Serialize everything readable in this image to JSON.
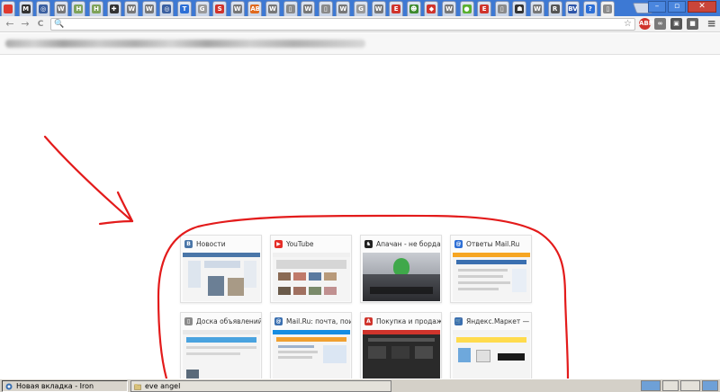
{
  "tabstrip": {
    "tabs": [
      {
        "icon": "opera-red-icon",
        "glyph": "",
        "color": "#e03a2f"
      },
      {
        "icon": "bar-icon",
        "glyph": "M",
        "color": "#333333"
      },
      {
        "icon": "gear-icon",
        "glyph": "◎",
        "color": "#3a5fa0"
      },
      {
        "icon": "wikipedia-icon",
        "glyph": "W",
        "color": "#777777"
      },
      {
        "icon": "h-icon",
        "glyph": "H",
        "color": "#7fa35a"
      },
      {
        "icon": "h-icon",
        "glyph": "H",
        "color": "#7fa35a"
      },
      {
        "icon": "cross-icon",
        "glyph": "✚",
        "color": "#333333"
      },
      {
        "icon": "wikipedia-icon",
        "glyph": "W",
        "color": "#777777"
      },
      {
        "icon": "wikipedia-icon",
        "glyph": "W",
        "color": "#777777"
      },
      {
        "icon": "gear-icon",
        "glyph": "◎",
        "color": "#3a5fa0"
      },
      {
        "icon": "t-icon",
        "glyph": "T",
        "color": "#2d6fd6"
      },
      {
        "icon": "google-icon",
        "glyph": "G",
        "color": "#9a9a9a"
      },
      {
        "icon": "s-icon",
        "glyph": "S",
        "color": "#d0342c"
      },
      {
        "icon": "wikipedia-icon",
        "glyph": "W",
        "color": "#777777"
      },
      {
        "icon": "ab-icon",
        "glyph": "AB",
        "color": "#e06a1e"
      },
      {
        "icon": "wikipedia-icon",
        "glyph": "W",
        "color": "#777777"
      },
      {
        "icon": "document-icon",
        "glyph": "▯",
        "color": "#8a8a8a"
      },
      {
        "icon": "wikipedia-icon",
        "glyph": "W",
        "color": "#777777"
      },
      {
        "icon": "document-icon",
        "glyph": "▯",
        "color": "#8a8a8a"
      },
      {
        "icon": "wikipedia-icon",
        "glyph": "W",
        "color": "#777777"
      },
      {
        "icon": "google-icon",
        "glyph": "G",
        "color": "#9a9a9a"
      },
      {
        "icon": "wikipedia-icon",
        "glyph": "W",
        "color": "#777777"
      },
      {
        "icon": "e-icon",
        "glyph": "E",
        "color": "#d0342c"
      },
      {
        "icon": "alien-icon",
        "glyph": "☻",
        "color": "#3d8a2e"
      },
      {
        "icon": "pocket-icon",
        "glyph": "◆",
        "color": "#d0342c"
      },
      {
        "icon": "wikipedia-icon",
        "glyph": "W",
        "color": "#777777"
      },
      {
        "icon": "green-ball-icon",
        "glyph": "●",
        "color": "#5bb030"
      },
      {
        "icon": "e-icon",
        "glyph": "E",
        "color": "#d0342c"
      },
      {
        "icon": "document-icon",
        "glyph": "▯",
        "color": "#8a8a8a"
      },
      {
        "icon": "mask-icon",
        "glyph": "☗",
        "color": "#333333"
      },
      {
        "icon": "wikipedia-icon",
        "glyph": "W",
        "color": "#777777"
      },
      {
        "icon": "r-icon",
        "glyph": "R",
        "color": "#555555"
      },
      {
        "icon": "bv-icon",
        "glyph": "BV",
        "color": "#2f56a8"
      },
      {
        "icon": "help-icon",
        "glyph": "?",
        "color": "#2d6fd6"
      },
      {
        "icon": "document-icon",
        "glyph": "▯",
        "color": "#8a8a8a"
      }
    ]
  },
  "toolbar": {
    "back_glyph": "←",
    "forward_glyph": "→",
    "reload_glyph": "C",
    "search_glyph": "🔍",
    "star_glyph": "☆",
    "address_value": "",
    "extensions": [
      {
        "icon": "adblock-icon",
        "glyph": "ABP",
        "color": "#d0342c"
      },
      {
        "icon": "chain-icon",
        "glyph": "∞",
        "color": "#7a7a7a"
      },
      {
        "icon": "puzzle-icon",
        "glyph": "▣",
        "color": "#555555"
      },
      {
        "icon": "lock-icon",
        "glyph": "■",
        "color": "#666666"
      }
    ],
    "menu_glyph": "≡"
  },
  "most_visited": [
    {
      "title": "Новости",
      "icon": "vk-icon",
      "glyph": "B",
      "color": "#4a76a8"
    },
    {
      "title": "YouTube",
      "icon": "youtube-icon",
      "glyph": "▶",
      "color": "#e52d27"
    },
    {
      "title": "Апачан - не борда (",
      "icon": "apachan-icon",
      "glyph": "♞",
      "color": "#222222"
    },
    {
      "title": "Ответы Mail.Ru",
      "icon": "mailru-answers-icon",
      "glyph": "@",
      "color": "#2d6fd6"
    },
    {
      "title": "Доска объявлений о",
      "icon": "document-icon",
      "glyph": "▯",
      "color": "#8a8a8a"
    },
    {
      "title": "Mail.Ru: почта, поис",
      "icon": "mailru-icon",
      "glyph": "@",
      "color": "#3a6fb0"
    },
    {
      "title": "Покупка и продажа",
      "icon": "avito-icon",
      "glyph": "A",
      "color": "#d0342c"
    },
    {
      "title": "Яндекс.Маркет — по",
      "icon": "cart-icon",
      "glyph": "🛒",
      "color": "#3a6fb0"
    }
  ],
  "taskbar": {
    "tasks": [
      {
        "label": "Новая вкладка - Iron",
        "icon": "iron-browser-icon"
      },
      {
        "label": "eve angel",
        "icon": "folder-icon"
      }
    ]
  },
  "colors": {
    "annotation": "#e31b1b",
    "tab_strip": "#3d79d4"
  }
}
